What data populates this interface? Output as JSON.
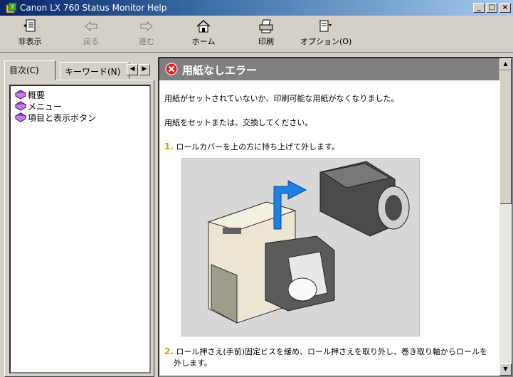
{
  "window": {
    "title": "Canon LX 760 Status Monitor Help",
    "controls": {
      "minimize": "_",
      "maximize": "□",
      "close": "×"
    }
  },
  "toolbar": {
    "hide": "非表示",
    "back": "戻る",
    "forward": "進む",
    "home": "ホーム",
    "print": "印刷",
    "options": "オプション(O)"
  },
  "nav": {
    "tabs": {
      "contents": "目次(C)",
      "keyword": "キーワード(N)"
    },
    "scroll_left": "◀",
    "scroll_right": "▶",
    "items": [
      {
        "label": "概要",
        "icon": "book-icon"
      },
      {
        "label": "メニュー",
        "icon": "book-icon"
      },
      {
        "label": "項目と表示ボタン",
        "icon": "book-icon"
      }
    ]
  },
  "content": {
    "heading": "用紙なしエラー",
    "paragraph1": "用紙がセットされていないか、印刷可能な用紙がなくなりました。",
    "paragraph2": "用紙をセットまたは、交換してください。",
    "steps": [
      {
        "num": "1.",
        "text": "ロールカバーを上の方に持ち上げて外します。"
      },
      {
        "num": "2.",
        "text": "ロール押さえ(手前)固定ビスを緩め、ロール押さえを取り外し、巻き取り軸からロールを",
        "text_cont": "外します。"
      }
    ],
    "scroll_up": "▲",
    "scroll_down": "▼"
  },
  "colors": {
    "title_start": "#0a246a",
    "title_end": "#a6caf0",
    "heading_bg": "#808080",
    "error_red": "#e02020",
    "step_num": "#d0a000"
  }
}
